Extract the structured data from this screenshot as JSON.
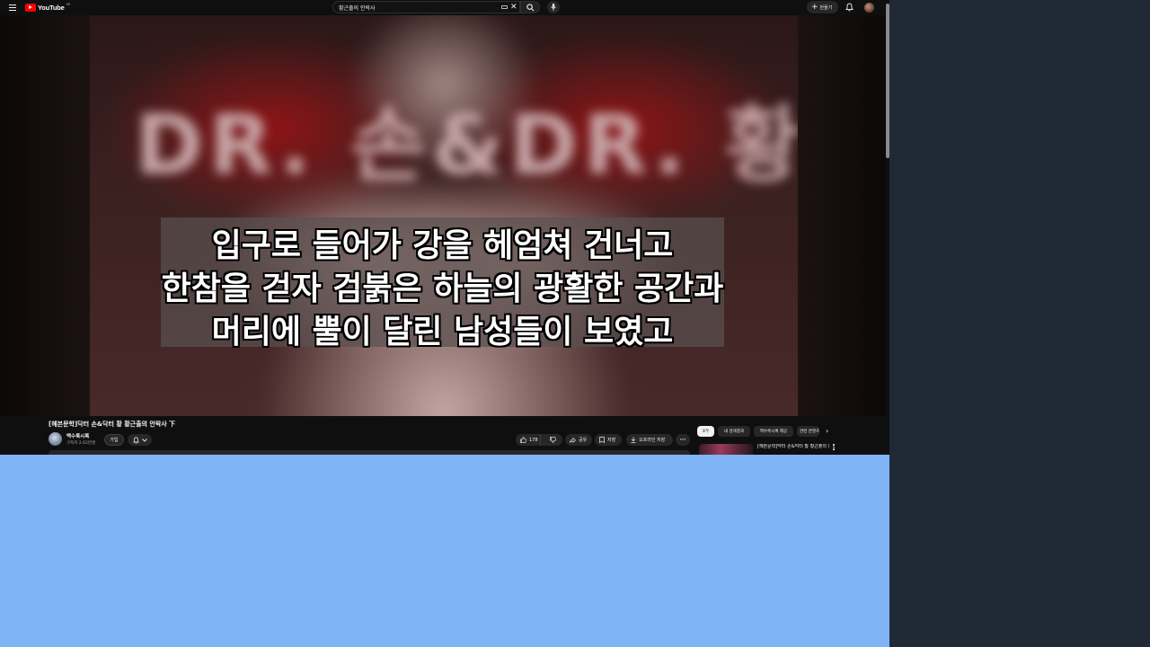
{
  "header": {
    "logo_text": "YouTube",
    "logo_region": "KR",
    "search_value": "황근출의 안락사",
    "create_label": "만들기"
  },
  "player": {
    "blurred_title": "DR. 손&DR. 황",
    "subtitles": [
      "입구로 들어가 강을 헤엄쳐 건너고",
      "한참을 걷자 검붉은 하늘의 광활한 공간과",
      "머리에 뿔이 달린 남성들이 보였고"
    ]
  },
  "video": {
    "title": "[헤븐문학]닥터 손&닥터 황 황근출의 안락사 下",
    "channel_name": "백수룩시록",
    "subscribers": "구독자 2.62만명",
    "join_label": "가입",
    "like_count": "178",
    "share_label": "공유",
    "clip_label": "저장",
    "offline_label": "오프라인 저장",
    "more_label": "···"
  },
  "sidebar": {
    "chips": [
      "모두",
      "내 검색결과",
      "백수룩시록 제공",
      "관련 콘텐츠"
    ],
    "recommendation_title": "[헤븐문학]닥터 손&닥터 황 황근출의 안락사 上"
  },
  "colors": {
    "page_bg": "#0f0f0f",
    "accent": "#ff0000",
    "pill_bg": "#272727",
    "lower_area": "#7fb4f6",
    "right_pane": "#1f2a36"
  },
  "icons": [
    "menu-icon",
    "youtube-logo-icon",
    "keyboard-icon",
    "clear-icon",
    "search-icon",
    "mic-icon",
    "plus-icon",
    "bell-icon",
    "avatar",
    "notification-bell-icon",
    "chevron-down-icon",
    "thumbs-up-icon",
    "thumbs-down-icon",
    "share-icon",
    "save-icon",
    "download-icon",
    "more-icon",
    "chevron-right-icon"
  ]
}
